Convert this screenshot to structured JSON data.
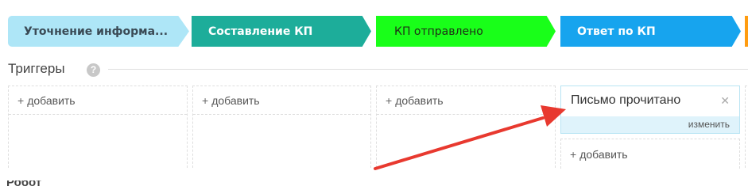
{
  "stages": [
    {
      "label": "Уточнение информа...",
      "color": "#aee6f7"
    },
    {
      "label": "Составление КП",
      "color": "#1dad9a"
    },
    {
      "label": "КП отправлено",
      "color": "#19ff19"
    },
    {
      "label": "Ответ по КП",
      "color": "#17a4ee"
    },
    {
      "label": "",
      "color": "#ff9c10"
    }
  ],
  "triggers_section": {
    "title": "Триггеры",
    "help_icon": "question-icon"
  },
  "columns": [
    {
      "add_label": "добавить"
    },
    {
      "add_label": "добавить"
    },
    {
      "add_label": "добавить"
    },
    {
      "trigger": {
        "name": "Письмо прочитано",
        "close_icon": "close-icon",
        "change_label": "изменить"
      },
      "add_label": "добавить"
    }
  ],
  "annotation": {
    "color": "#e8392f"
  },
  "next_section": {
    "title": "Робот"
  }
}
